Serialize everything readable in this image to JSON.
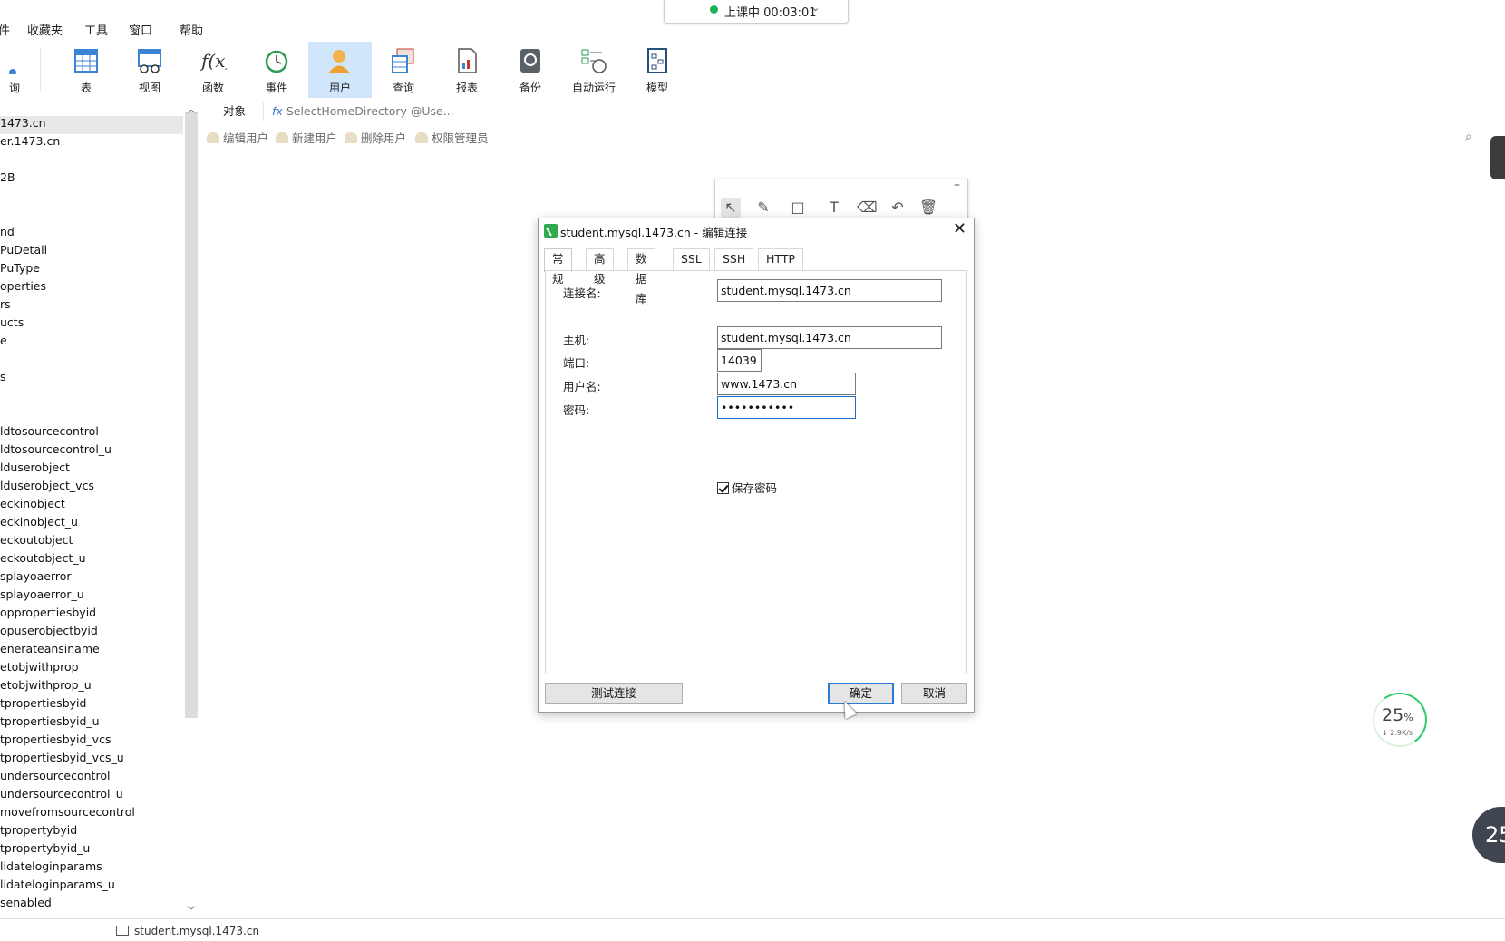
{
  "menu": [
    "件",
    "收藏夹",
    "工具",
    "窗口",
    "帮助"
  ],
  "class_status": {
    "text": "上课中 00:03:01"
  },
  "toolbar": {
    "partial_left_label": "询",
    "buttons": [
      {
        "label": "表"
      },
      {
        "label": "视图"
      },
      {
        "label": "函数"
      },
      {
        "label": "事件"
      },
      {
        "label": "用户"
      },
      {
        "label": "查询"
      },
      {
        "label": "报表"
      },
      {
        "label": "备份"
      },
      {
        "label": "自动运行"
      },
      {
        "label": "模型"
      }
    ]
  },
  "tree": {
    "items": [
      "1473.cn",
      "er.1473.cn",
      "2B",
      "nd",
      "PuDetail",
      "PuType",
      "operties",
      "rs",
      "ucts",
      "e",
      "s",
      "ldtosourcecontrol",
      "ldtosourcecontrol_u",
      "lduserobject",
      "lduserobject_vcs",
      "eckinobject",
      "eckinobject_u",
      "eckoutobject",
      "eckoutobject_u",
      "splayoaerror",
      "splayoaerror_u",
      "oppropertiesbyid",
      "opuserobjectbyid",
      "enerateansiname",
      "etobjwithprop",
      "etobjwithprop_u",
      "tpropertiesbyid",
      "tpropertiesbyid_u",
      "tpropertiesbyid_vcs",
      "tpropertiesbyid_vcs_u",
      "undersourcecontrol",
      "undersourcecontrol_u",
      "movefromsourcecontrol",
      "tpropertybyid",
      "tpropertybyid_u",
      "lidateloginparams",
      "lidateloginparams_u",
      "senabled"
    ]
  },
  "object_area": {
    "tab_label": "对象",
    "fx_text": "SelectHomeDirectory @Use...",
    "actions": [
      "编辑用户",
      "新建用户",
      "删除用户",
      "权限管理员"
    ]
  },
  "dialog": {
    "title": "student.mysql.1473.cn - 编辑连接",
    "tabs": [
      "常规",
      "高级",
      "数据库",
      "SSL",
      "SSH",
      "HTTP"
    ],
    "fields": {
      "connection_name_label": "连接名:",
      "connection_name_value": "student.mysql.1473.cn",
      "host_label": "主机:",
      "host_value": "student.mysql.1473.cn",
      "port_label": "端口:",
      "port_value": "14039",
      "username_label": "用户名:",
      "username_value": "www.1473.cn",
      "password_label": "密码:",
      "password_value": "•••••••••••"
    },
    "save_password_label": "保存密码",
    "save_password_checked": true,
    "buttons": {
      "test": "测试连接",
      "ok": "确定",
      "cancel": "取消"
    }
  },
  "net_widget": {
    "percent": "25",
    "percent_unit": "%",
    "speed": "↓ 2.9K/s"
  },
  "corner_badge": "25",
  "statusbar": {
    "text": "student.mysql.1473.cn"
  },
  "colors": {
    "accent": "#2a7bd5",
    "toolbar_active": "#cfe6fb",
    "status_dot": "#1fb25a"
  }
}
